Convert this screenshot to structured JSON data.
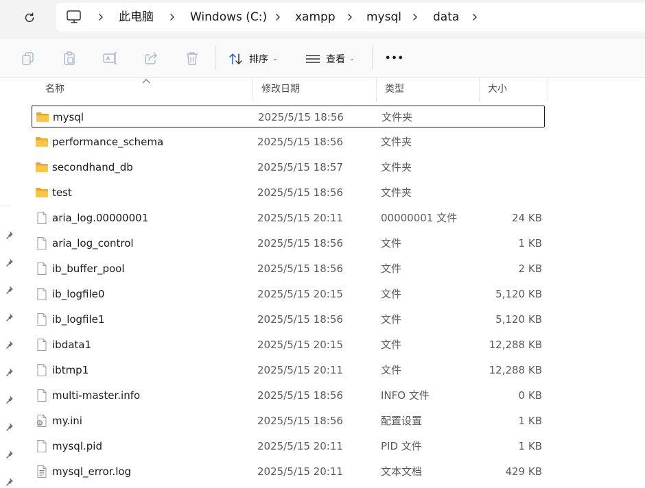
{
  "breadcrumb": {
    "items": [
      "此电脑",
      "Windows (C:)",
      "xampp",
      "mysql",
      "data"
    ]
  },
  "toolbar": {
    "sort_label": "排序",
    "view_label": "查看",
    "more_label": "•••"
  },
  "columns": {
    "name": "名称",
    "date": "修改日期",
    "type": "类型",
    "size": "大小"
  },
  "files": [
    {
      "name": "mysql",
      "date": "2025/5/15 18:56",
      "type": "文件夹",
      "size": "",
      "icon": "folder-icon"
    },
    {
      "name": "performance_schema",
      "date": "2025/5/15 18:56",
      "type": "文件夹",
      "size": "",
      "icon": "folder-icon"
    },
    {
      "name": "secondhand_db",
      "date": "2025/5/15 18:57",
      "type": "文件夹",
      "size": "",
      "icon": "folder-icon"
    },
    {
      "name": "test",
      "date": "2025/5/15 18:56",
      "type": "文件夹",
      "size": "",
      "icon": "folder-icon"
    },
    {
      "name": "aria_log.00000001",
      "date": "2025/5/15 20:11",
      "type": "00000001 文件",
      "size": "24 KB",
      "icon": "file-icon"
    },
    {
      "name": "aria_log_control",
      "date": "2025/5/15 18:56",
      "type": "文件",
      "size": "1 KB",
      "icon": "file-icon"
    },
    {
      "name": "ib_buffer_pool",
      "date": "2025/5/15 18:56",
      "type": "文件",
      "size": "2 KB",
      "icon": "file-icon"
    },
    {
      "name": "ib_logfile0",
      "date": "2025/5/15 20:15",
      "type": "文件",
      "size": "5,120 KB",
      "icon": "file-icon"
    },
    {
      "name": "ib_logfile1",
      "date": "2025/5/15 18:56",
      "type": "文件",
      "size": "5,120 KB",
      "icon": "file-icon"
    },
    {
      "name": "ibdata1",
      "date": "2025/5/15 20:15",
      "type": "文件",
      "size": "12,288 KB",
      "icon": "file-icon"
    },
    {
      "name": "ibtmp1",
      "date": "2025/5/15 20:11",
      "type": "文件",
      "size": "12,288 KB",
      "icon": "file-icon"
    },
    {
      "name": "multi-master.info",
      "date": "2025/5/15 18:56",
      "type": "INFO 文件",
      "size": "0 KB",
      "icon": "file-icon"
    },
    {
      "name": "my.ini",
      "date": "2025/5/15 18:56",
      "type": "配置设置",
      "size": "1 KB",
      "icon": "settings-file-icon"
    },
    {
      "name": "mysql.pid",
      "date": "2025/5/15 20:11",
      "type": "PID 文件",
      "size": "1 KB",
      "icon": "file-icon"
    },
    {
      "name": "mysql_error.log",
      "date": "2025/5/15 20:11",
      "type": "文本文档",
      "size": "429 KB",
      "icon": "text-file-icon"
    }
  ],
  "selected_index": 0,
  "colors": {
    "folder": "#f8c64a",
    "folder_dark": "#e9a825",
    "icon_gray": "#9a9a9a",
    "accent_sort": "#3a6fd8"
  }
}
